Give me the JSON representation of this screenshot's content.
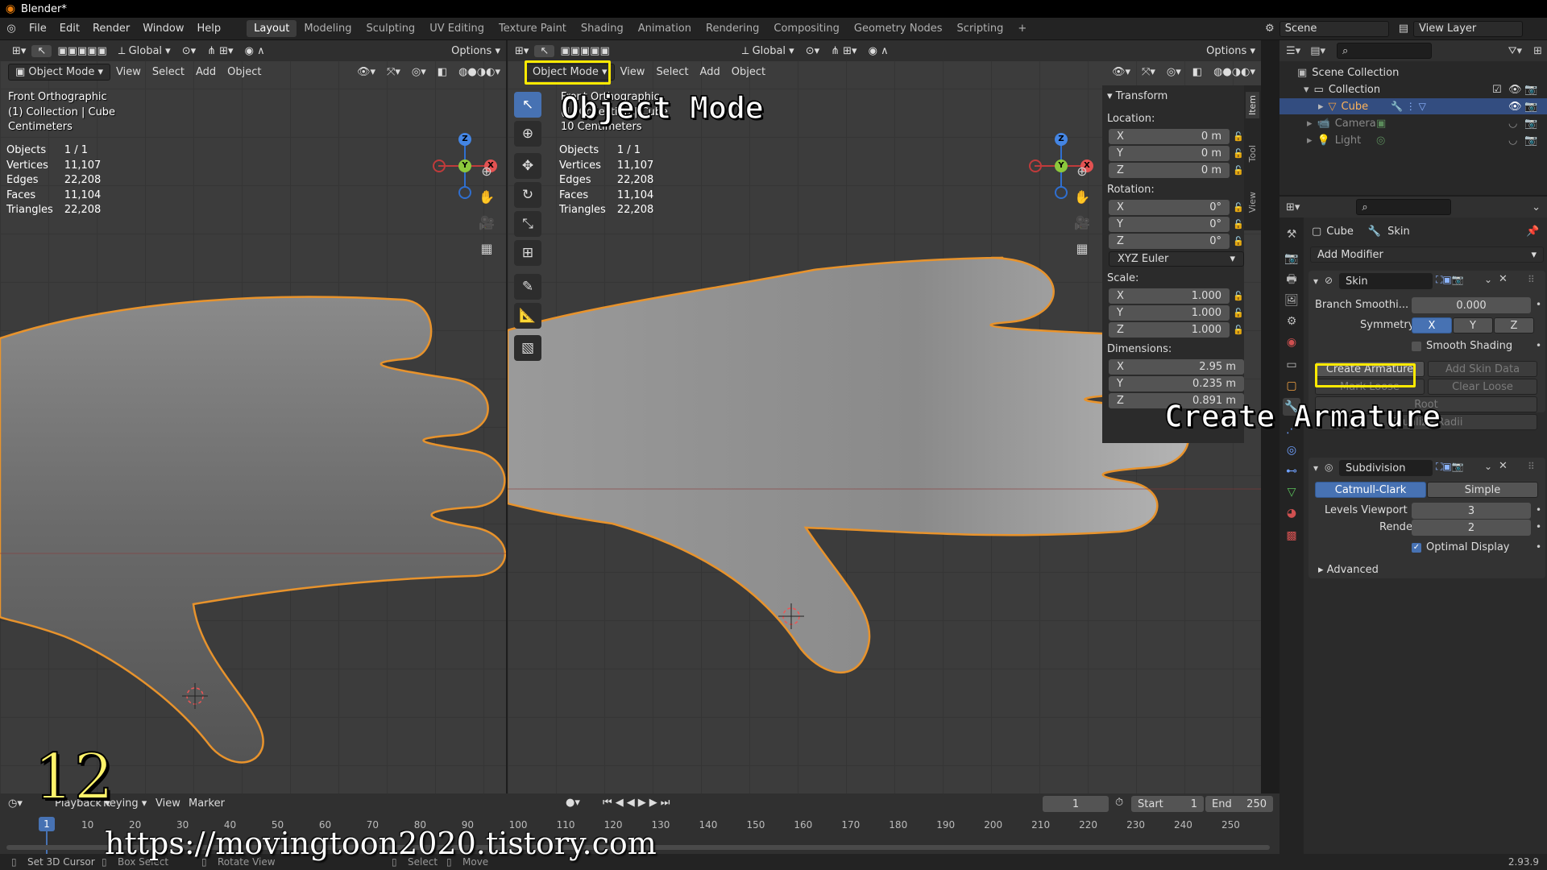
{
  "window": {
    "title": "Blender*",
    "version": "2.93.9"
  },
  "menu": [
    "File",
    "Edit",
    "Render",
    "Window",
    "Help"
  ],
  "workspaces": [
    "Layout",
    "Modeling",
    "Sculpting",
    "UV Editing",
    "Texture Paint",
    "Shading",
    "Animation",
    "Rendering",
    "Compositing",
    "Geometry Nodes",
    "Scripting"
  ],
  "active_workspace": "Layout",
  "scene": {
    "name": "Scene",
    "view_layer": "View Layer"
  },
  "viewport_left": {
    "header": {
      "orientation": "Global",
      "options": "Options",
      "mode": "Object Mode",
      "menu": [
        "View",
        "Select",
        "Add",
        "Object"
      ]
    },
    "info": [
      "Front Orthographic",
      "(1) Collection | Cube",
      "Centimeters"
    ],
    "stats": [
      [
        "Objects",
        "1 / 1"
      ],
      [
        "Vertices",
        "11,107"
      ],
      [
        "Edges",
        "22,208"
      ],
      [
        "Faces",
        "11,104"
      ],
      [
        "Triangles",
        "22,208"
      ]
    ]
  },
  "viewport_right": {
    "header": {
      "orientation": "Global",
      "options": "Options",
      "mode": "Object Mode",
      "menu": [
        "View",
        "Select",
        "Add",
        "Object"
      ]
    },
    "info": [
      "Front Orthographic",
      "(1) Collection | Cube",
      "10 Centimeters"
    ],
    "stats": [
      [
        "Objects",
        "1 / 1"
      ],
      [
        "Vertices",
        "11,107"
      ],
      [
        "Edges",
        "22,208"
      ],
      [
        "Faces",
        "11,104"
      ],
      [
        "Triangles",
        "22,208"
      ]
    ]
  },
  "gizmo": {
    "x": "X",
    "y": "Y",
    "z": "Z"
  },
  "npanel": {
    "title": "Transform",
    "tabs": [
      "Item",
      "Tool",
      "View"
    ],
    "location_label": "Location:",
    "location": [
      [
        "X",
        "0 m"
      ],
      [
        "Y",
        "0 m"
      ],
      [
        "Z",
        "0 m"
      ]
    ],
    "rotation_label": "Rotation:",
    "rotation": [
      [
        "X",
        "0°"
      ],
      [
        "Y",
        "0°"
      ],
      [
        "Z",
        "0°"
      ]
    ],
    "rotation_mode": "XYZ Euler",
    "scale_label": "Scale:",
    "scale": [
      [
        "X",
        "1.000"
      ],
      [
        "Y",
        "1.000"
      ],
      [
        "Z",
        "1.000"
      ]
    ],
    "dimensions_label": "Dimensions:",
    "dimensions": [
      [
        "X",
        "2.95 m"
      ],
      [
        "Y",
        "0.235 m"
      ],
      [
        "Z",
        "0.891 m"
      ]
    ]
  },
  "outliner": {
    "items": [
      {
        "label": "Scene Collection",
        "indent": 0
      },
      {
        "label": "Collection",
        "indent": 1
      },
      {
        "label": "Cube",
        "indent": 2
      },
      {
        "label": "Camera",
        "indent": 2
      },
      {
        "label": "Light",
        "indent": 2
      }
    ]
  },
  "properties": {
    "breadcrumb_object": "Cube",
    "breadcrumb_modifier": "Skin",
    "add_modifier": "Add Modifier",
    "skin": {
      "name": "Skin",
      "branch_label": "Branch Smoothi...",
      "branch_value": "0.000",
      "symmetry_label": "Symmetry",
      "sym_x": "X",
      "sym_y": "Y",
      "sym_z": "Z",
      "smooth_shading": "Smooth Shading",
      "create_armature": "Create Armature",
      "add_skin_data": "Add Skin Data",
      "mark_loose": "Mark Loose",
      "clear_loose": "Clear Loose",
      "mark_root": "Root",
      "equalize_radii": "Equalize Radii"
    },
    "subdivision": {
      "name": "Subdivision",
      "catmull": "Catmull-Clark",
      "simple": "Simple",
      "levels_label": "Levels Viewport",
      "levels_value": "3",
      "render_label": "Render",
      "render_value": "2",
      "optimal": "Optimal Display",
      "advanced": "Advanced"
    }
  },
  "timeline": {
    "menu": [
      "Playback",
      "Keying",
      "View",
      "Marker"
    ],
    "current_frame": "1",
    "start_label": "Start",
    "start": "1",
    "end_label": "End",
    "end": "250",
    "ticks": [
      "1",
      "10",
      "20",
      "30",
      "40",
      "50",
      "60",
      "70",
      "80",
      "90",
      "100",
      "110",
      "120",
      "130",
      "140",
      "150",
      "160",
      "170",
      "180",
      "190",
      "200",
      "210",
      "220",
      "230",
      "240",
      "250"
    ]
  },
  "statusbar": {
    "items": [
      "Set 3D Cursor",
      "Box Select",
      "Rotate View",
      "Select",
      "Move"
    ]
  },
  "annotations": {
    "object_mode": "Object Mode",
    "create_armature": "Create Armature",
    "step_number": "12",
    "watermark": "https://movingtoon2020.tistory.com"
  }
}
